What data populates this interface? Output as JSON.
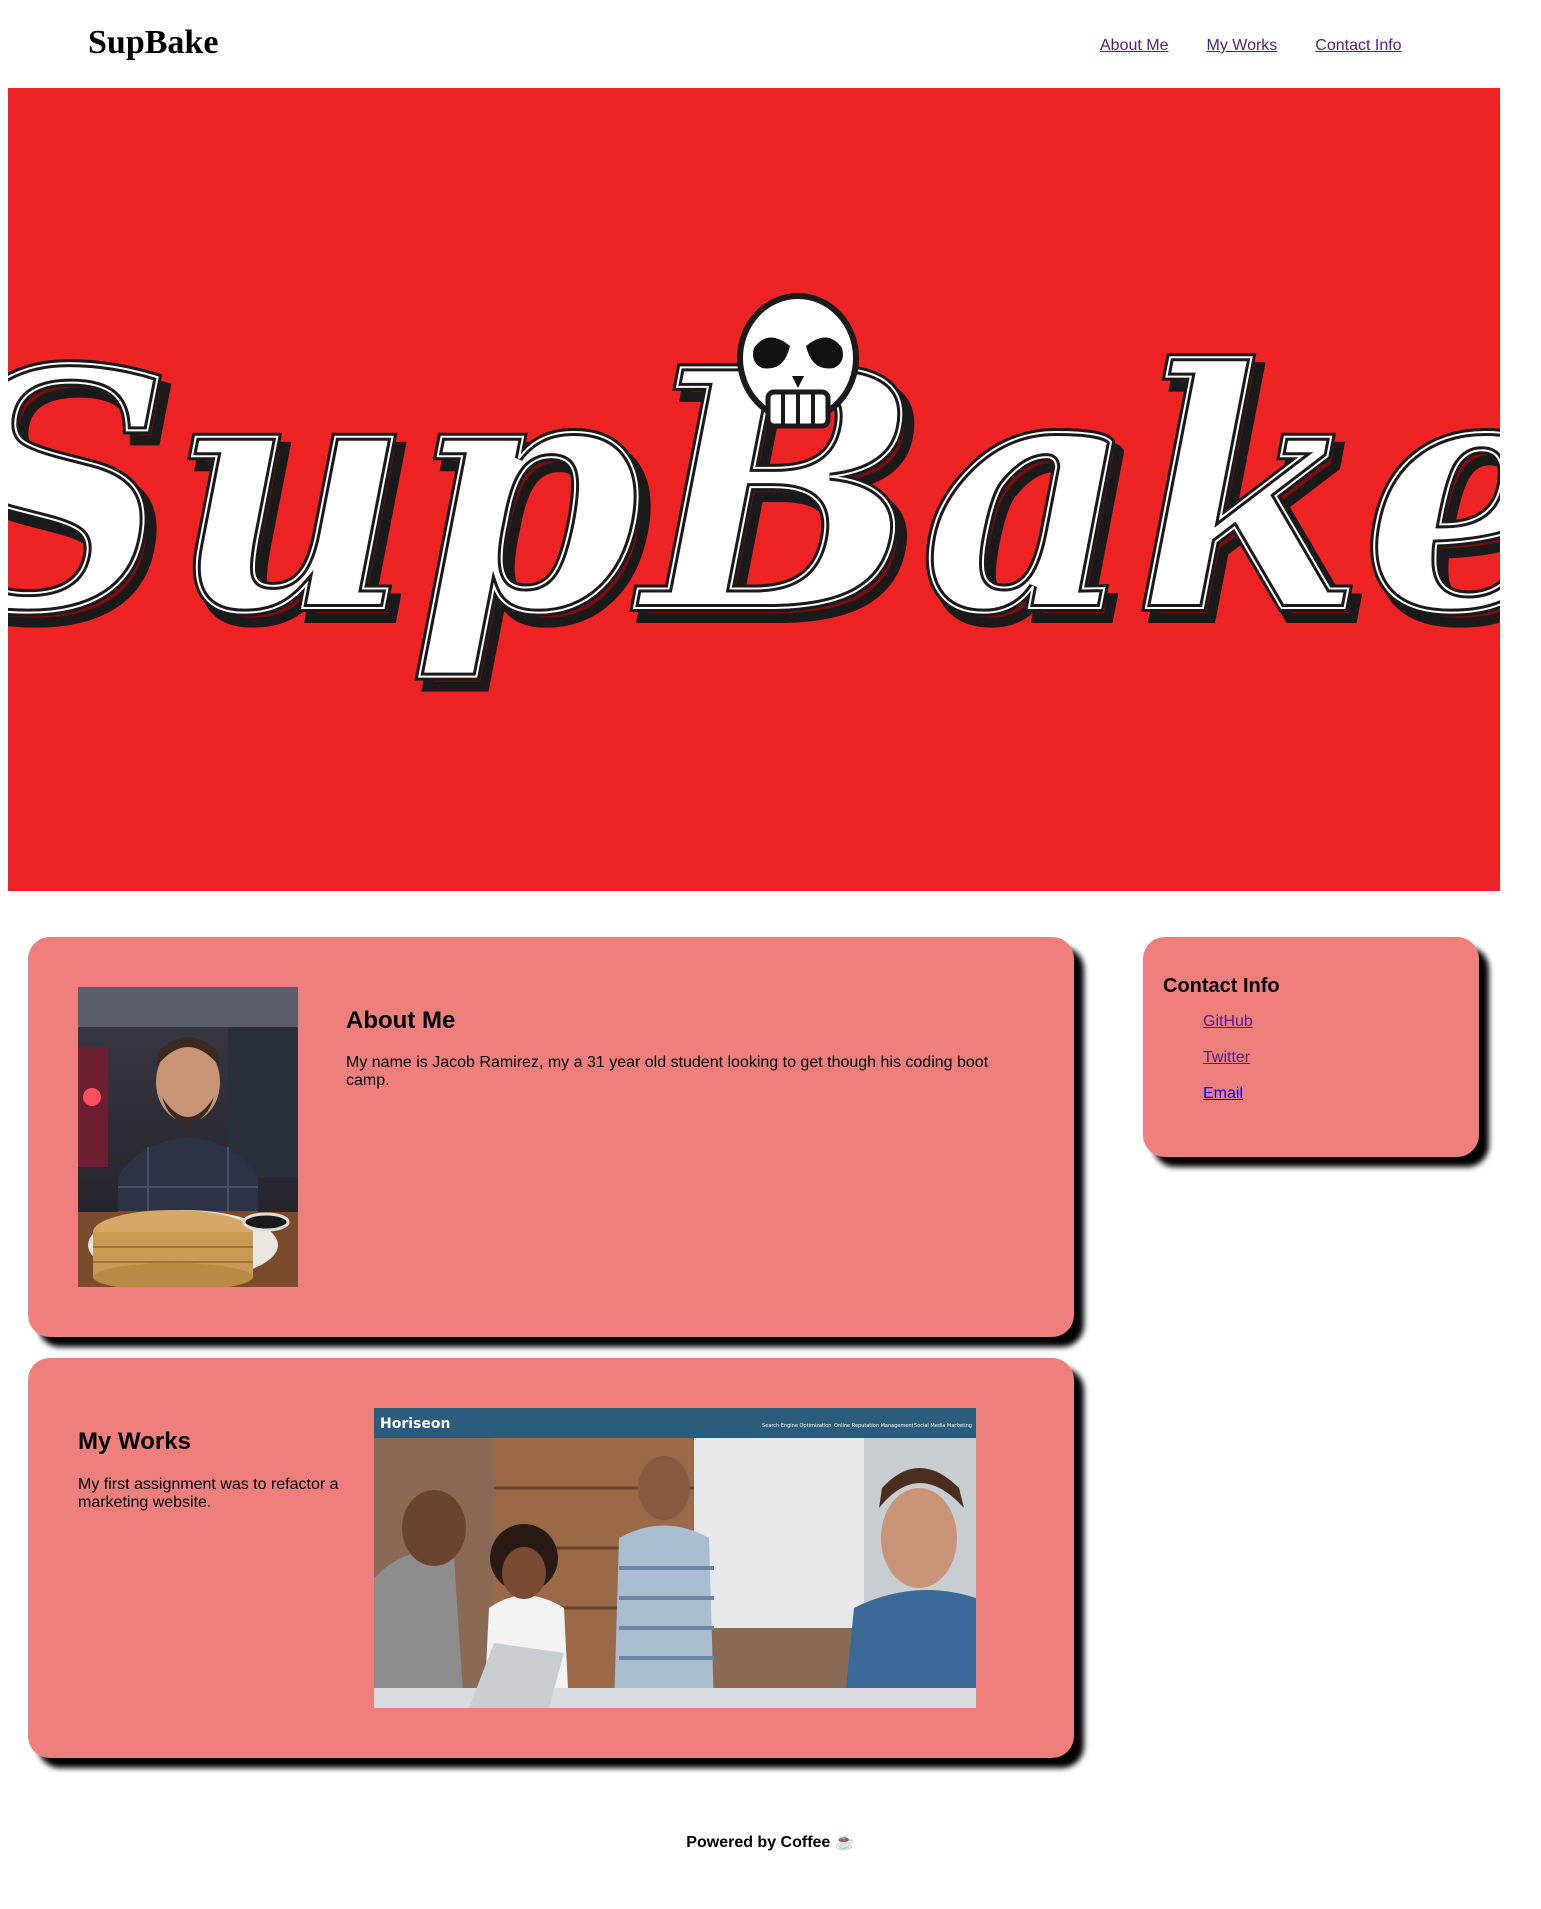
{
  "header": {
    "brand": "SupBake",
    "nav": [
      {
        "label": "About Me"
      },
      {
        "label": "My Works"
      },
      {
        "label": "Contact Info"
      }
    ]
  },
  "hero": {
    "logo_text": "SupBake",
    "background_color": "#ed2324"
  },
  "about": {
    "title": "About Me",
    "text": "My name is Jacob Ramirez, my a 31 year old student looking to get though his coding boot camp."
  },
  "works": {
    "title": "My Works",
    "text": "My first assignment was to refactor a marketing website.",
    "screenshot_brand": "Horiseon",
    "screenshot_nav": [
      "Search Engine Optimization",
      "Online Reputation Management",
      "Social Media Marketing"
    ]
  },
  "contact": {
    "title": "Contact Info",
    "links": [
      {
        "label": "GitHub"
      },
      {
        "label": "Twitter"
      },
      {
        "label": "Email"
      }
    ]
  },
  "footer": {
    "text": "Powered by Coffee ☕"
  },
  "colors": {
    "card": "#ee7f7c",
    "link_visited": "#551a8b",
    "link": "#0000ee"
  }
}
